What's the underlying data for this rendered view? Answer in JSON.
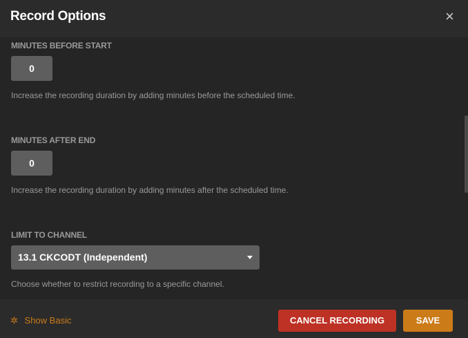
{
  "header": {
    "title": "Record Options",
    "close_icon": "×"
  },
  "fields": {
    "before": {
      "label": "MINUTES BEFORE START",
      "value": "0",
      "help": "Increase the recording duration by adding minutes before the scheduled time."
    },
    "after": {
      "label": "MINUTES AFTER END",
      "value": "0",
      "help": "Increase the recording duration by adding minutes after the scheduled time."
    },
    "channel": {
      "label": "LIMIT TO CHANNEL",
      "value": "13.1 CKCODT (Independent)",
      "help": "Choose whether to restrict recording to a specific channel."
    }
  },
  "footer": {
    "gear_icon": "✲",
    "show_basic": "Show Basic",
    "cancel": "CANCEL RECORDING",
    "save": "SAVE"
  },
  "colors": {
    "accent": "#cc7b19",
    "danger": "#bd3225"
  }
}
